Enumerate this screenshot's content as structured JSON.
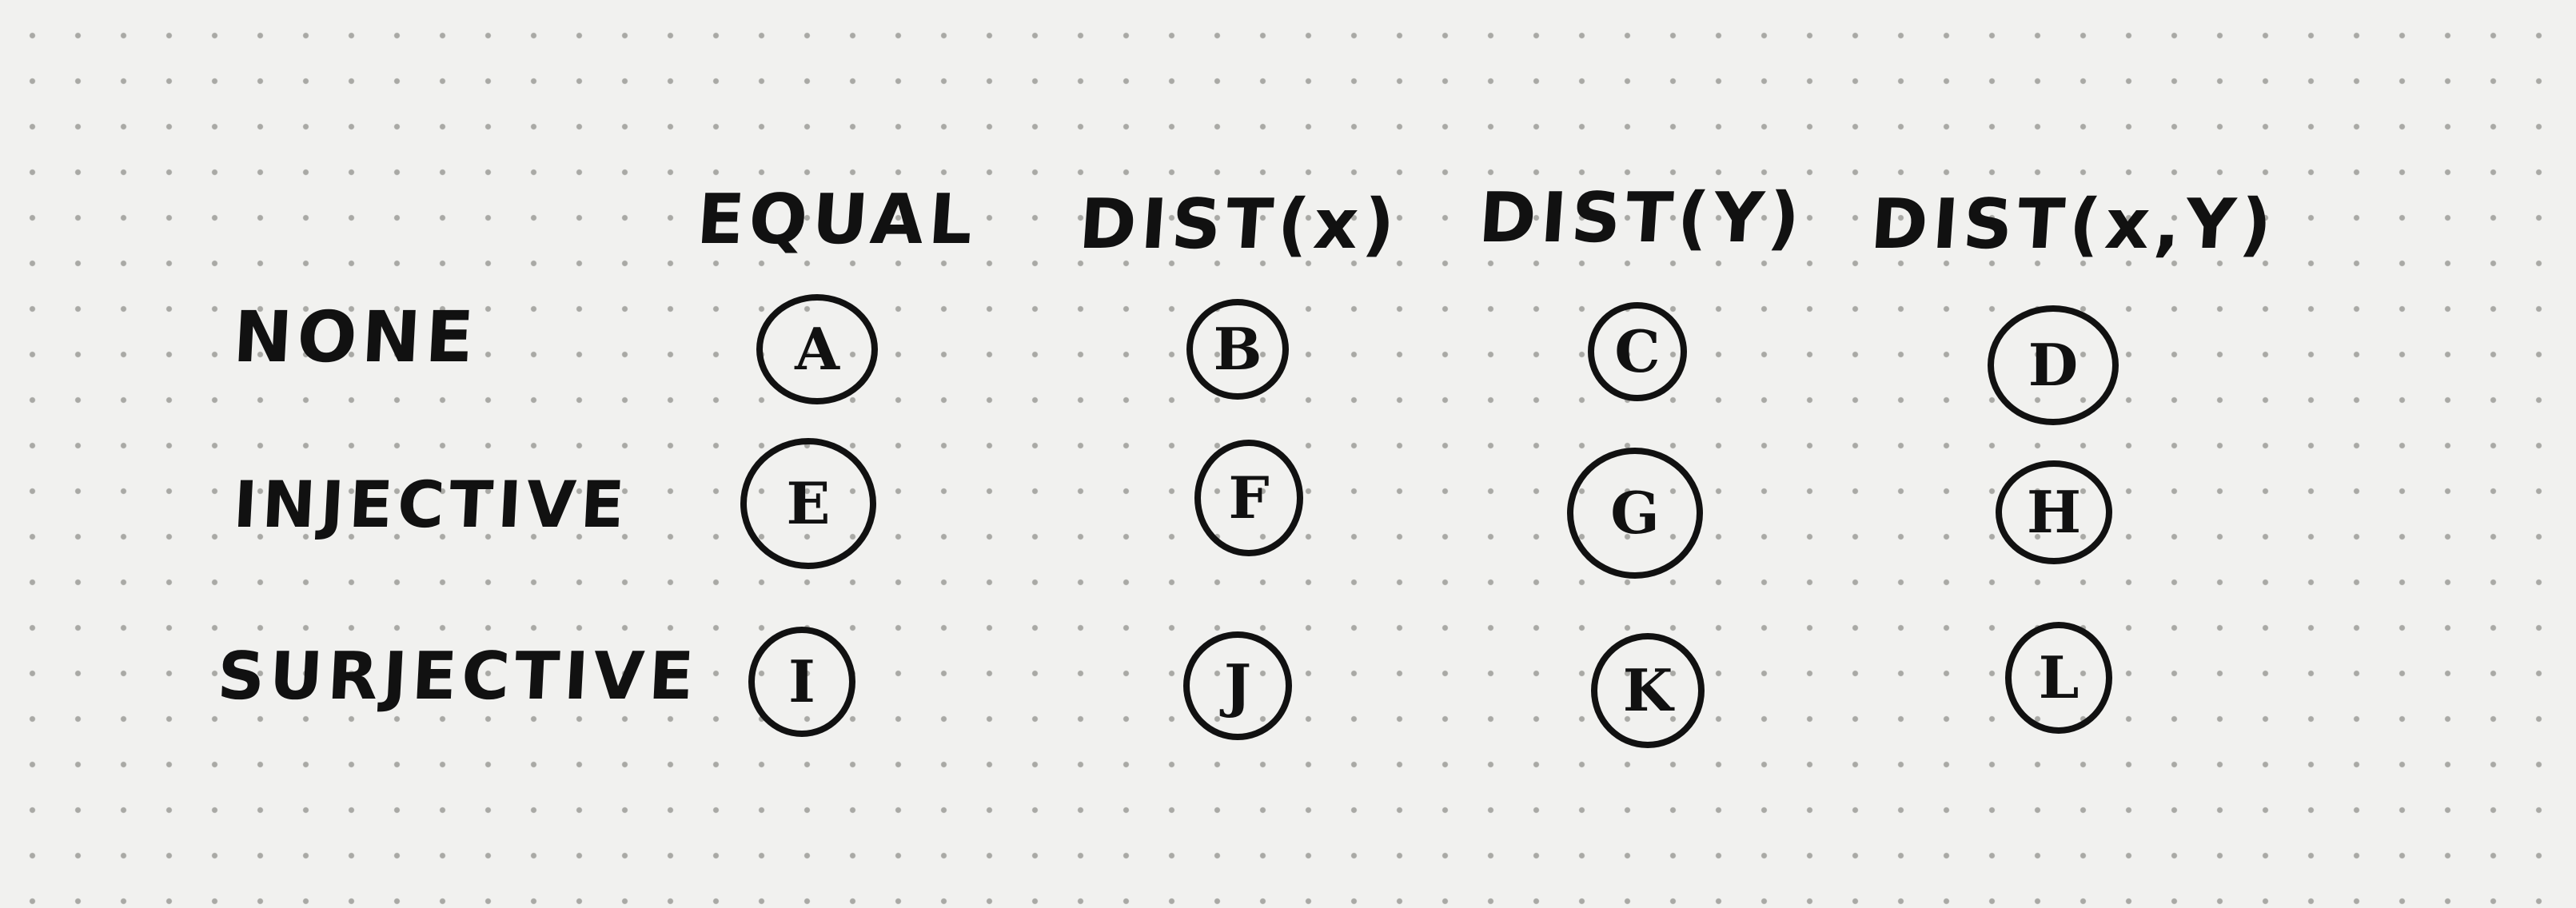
{
  "columns": [
    {
      "label": "EQUAL"
    },
    {
      "label": "DIST(x)"
    },
    {
      "label": "DIST(Y)"
    },
    {
      "label": "DIST(x,Y)"
    }
  ],
  "rows": [
    {
      "label": "NONE",
      "cells": [
        "A",
        "B",
        "C",
        "D"
      ]
    },
    {
      "label": "INJECTIVE",
      "cells": [
        "E",
        "F",
        "G",
        "H"
      ]
    },
    {
      "label": "SURJECTIVE",
      "cells": [
        "I",
        "J",
        "K",
        "L"
      ]
    }
  ]
}
